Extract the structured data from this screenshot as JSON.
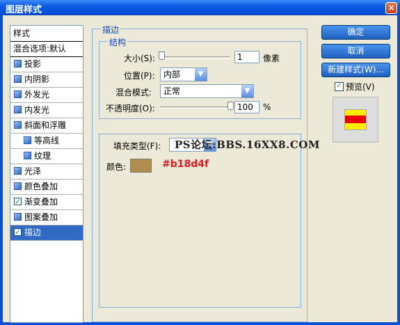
{
  "window": {
    "title": "图层样式",
    "close_glyph": "×"
  },
  "left_panel": {
    "header": "样式",
    "blend_options": "混合选项:默认",
    "items": [
      {
        "label": "投影",
        "checked": false
      },
      {
        "label": "内阴影",
        "checked": false
      },
      {
        "label": "外发光",
        "checked": false
      },
      {
        "label": "内发光",
        "checked": false
      },
      {
        "label": "斜面和浮雕",
        "checked": false
      },
      {
        "label": "等高线",
        "checked": false
      },
      {
        "label": "纹理",
        "checked": false
      },
      {
        "label": "光泽",
        "checked": false
      },
      {
        "label": "颜色叠加",
        "checked": false
      },
      {
        "label": "渐变叠加",
        "checked": true
      },
      {
        "label": "图案叠加",
        "checked": false
      },
      {
        "label": "描边",
        "checked": true
      }
    ]
  },
  "stroke": {
    "group_title": "描边",
    "structure_title": "结构",
    "size_label": "大小(S):",
    "size_value": "1",
    "size_unit": "像素",
    "position_label": "位置(P):",
    "position_value": "内部",
    "blend_mode_label": "混合模式:",
    "blend_mode_value": "正常",
    "opacity_label": "不透明度(O):",
    "opacity_value": "100",
    "opacity_unit": "%",
    "fill_type_label": "填充类型(F):",
    "color_label": "颜色:",
    "color_swatch": "#b18d4f",
    "color_hex_text": "#b18d4f"
  },
  "buttons": {
    "ok": "确定",
    "cancel": "取消",
    "new_style": "新建样式(W)...",
    "preview_label": "预览(V)",
    "preview_checked": true
  },
  "watermark": "PS论坛:BBS.16XX8.COM"
}
